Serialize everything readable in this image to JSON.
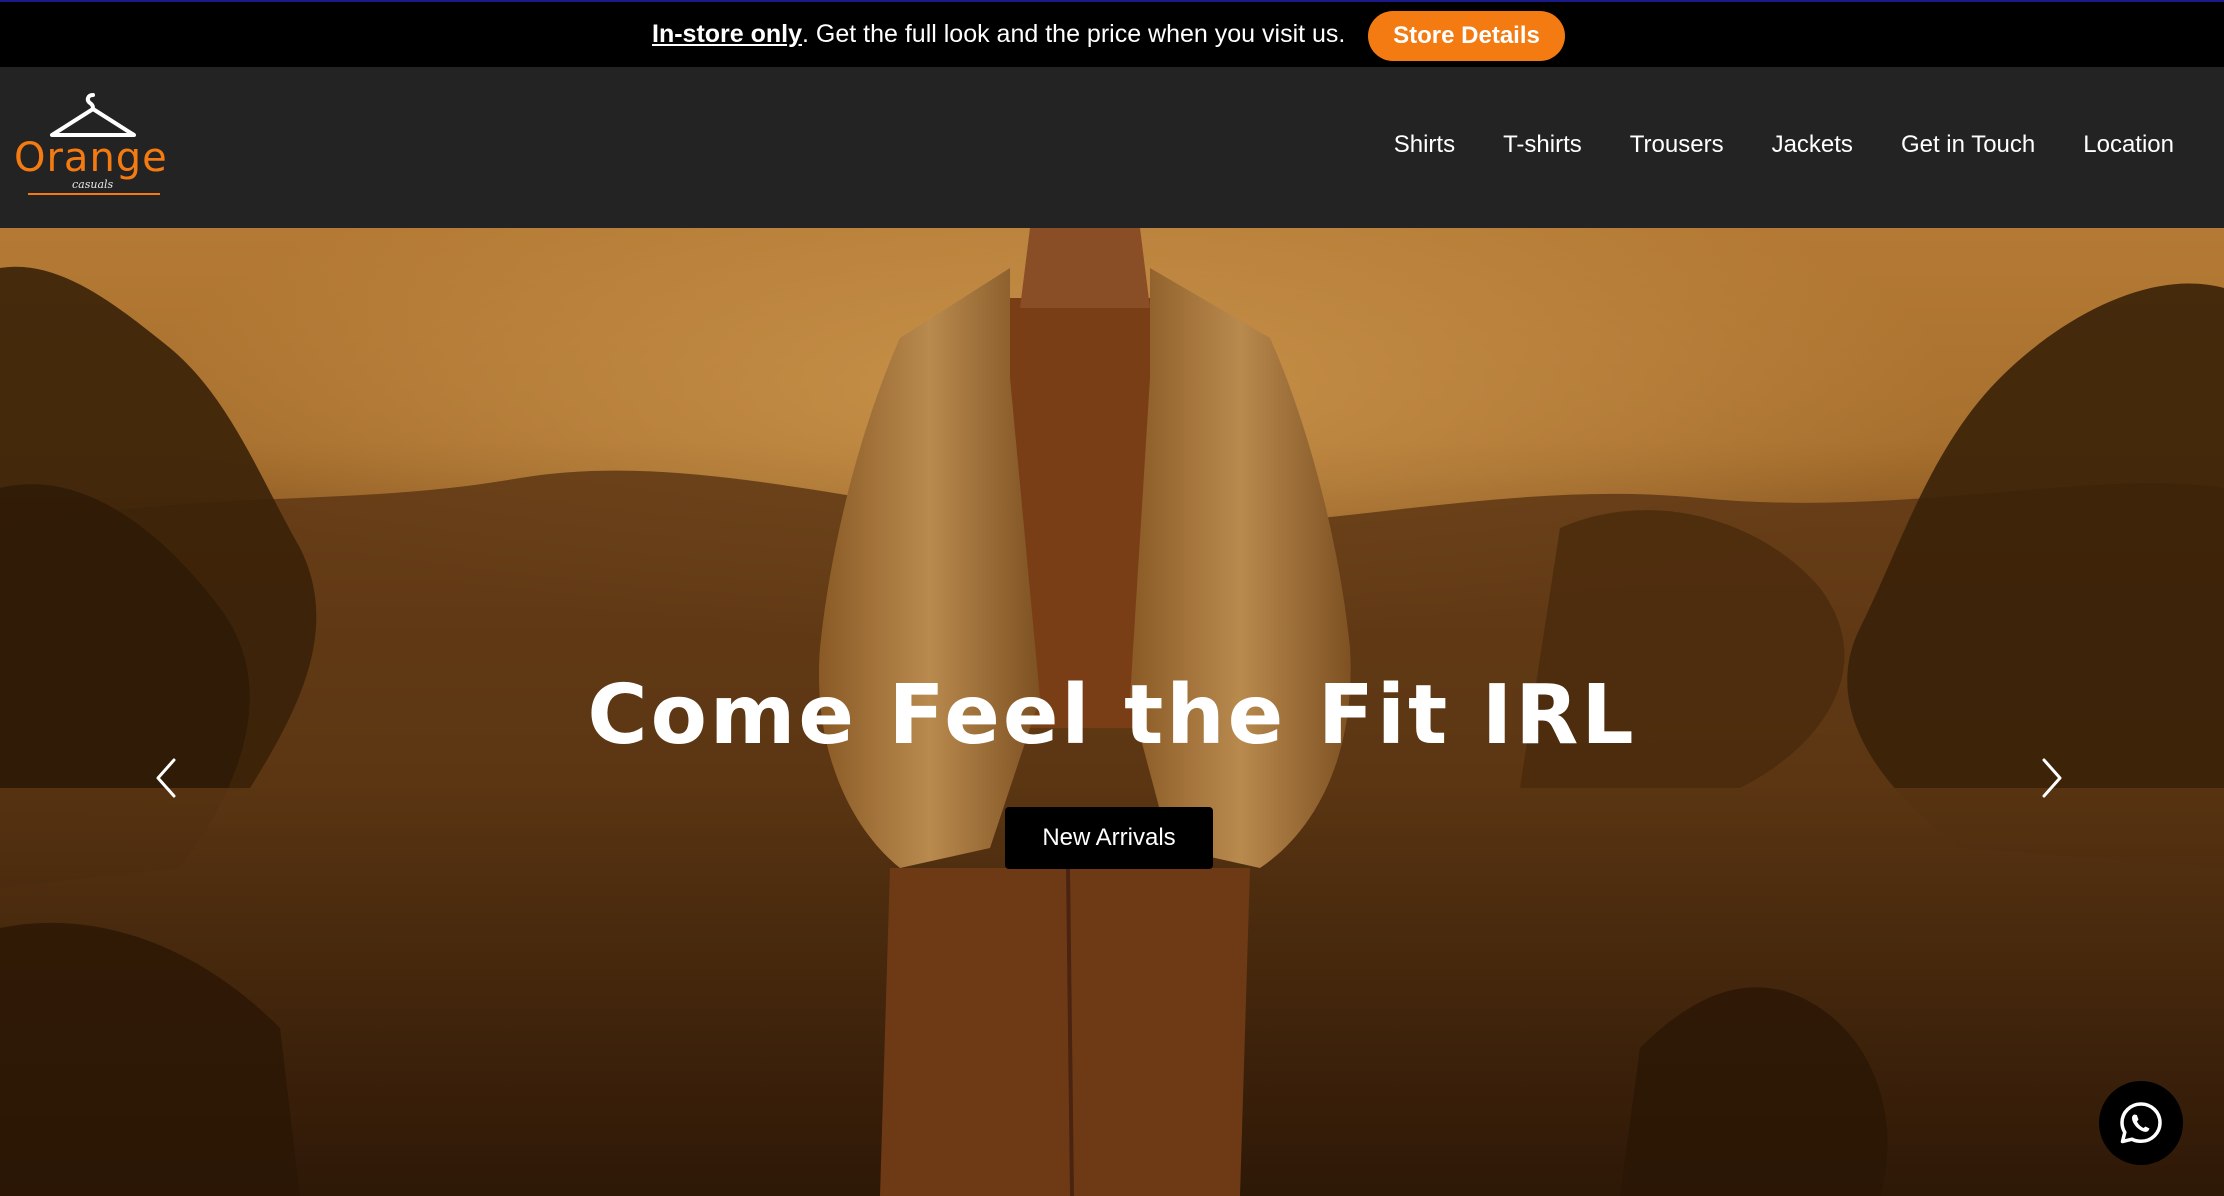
{
  "announcement": {
    "strong": "In-store only",
    "text": ". Get the full look and the price when you visit us.",
    "button": "Store Details"
  },
  "brand": {
    "name": "Orange",
    "subtitle": "casuals"
  },
  "nav": {
    "items": [
      "Shirts",
      "T-shirts",
      "Trousers",
      "Jackets",
      "Get in Touch",
      "Location"
    ]
  },
  "hero": {
    "title": "Come Feel the Fit IRL",
    "button": "New Arrivals"
  },
  "icons": {
    "logo": "hanger-icon",
    "prev": "chevron-left-icon",
    "next": "chevron-right-icon",
    "chat": "whatsapp-icon"
  },
  "colors": {
    "accent": "#f47a12",
    "announcement_bg": "#000000",
    "header_bg": "#232323",
    "hero_button_bg": "#000000"
  }
}
